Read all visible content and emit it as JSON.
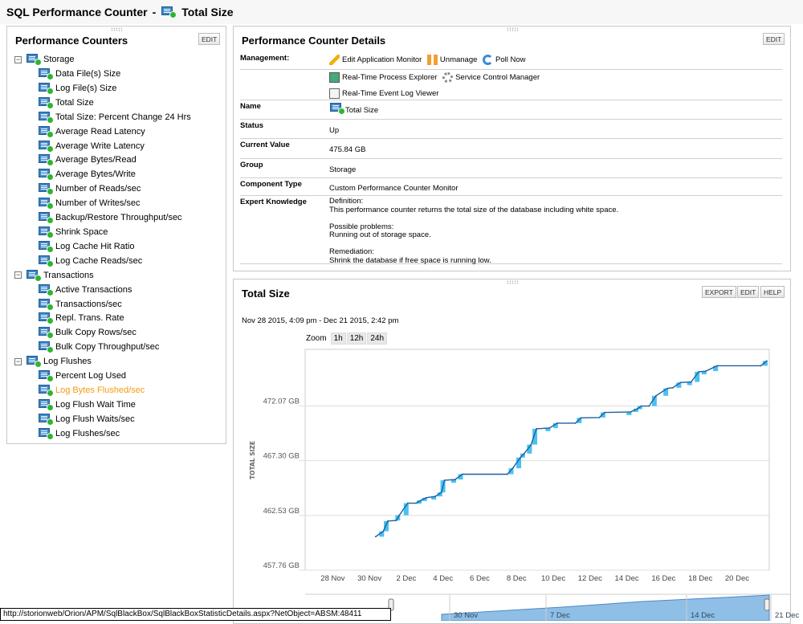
{
  "header": {
    "title": "SQL Performance Counter",
    "separator": "-",
    "counter": "Total Size"
  },
  "tree": {
    "title": "Performance Counters",
    "edit": "EDIT",
    "groups": [
      {
        "label": "Storage",
        "items": [
          "Data File(s) Size",
          "Log File(s) Size",
          "Total Size",
          "Total Size: Percent Change 24 Hrs",
          "Average Read Latency",
          "Average Write Latency",
          "Average Bytes/Read",
          "Average Bytes/Write",
          "Number of Reads/sec",
          "Number of Writes/sec",
          "Backup/Restore Throughput/sec",
          "Shrink Space",
          "Log Cache Hit Ratio",
          "Log Cache Reads/sec"
        ]
      },
      {
        "label": "Transactions",
        "items": [
          "Active Transactions",
          "Transactions/sec",
          "Repl. Trans. Rate",
          "Bulk Copy Rows/sec",
          "Bulk Copy Throughput/sec"
        ]
      },
      {
        "label": "Log Flushes",
        "items": [
          "Percent Log Used",
          "Log Bytes Flushed/sec",
          "Log Flush Wait Time",
          "Log Flush Waits/sec",
          "Log Flushes/sec"
        ]
      }
    ],
    "highlighted": "Log Bytes Flushed/sec",
    "highlight_color": "#f39c12"
  },
  "details": {
    "title": "Performance Counter Details",
    "edit": "EDIT",
    "management_label": "Management:",
    "management": {
      "edit_app": "Edit Application Monitor",
      "unmanage": "Unmanage",
      "poll": "Poll Now",
      "process_explorer": "Real-Time Process Explorer",
      "scm": "Service Control Manager",
      "event_log": "Real-Time Event Log Viewer"
    },
    "rows": [
      {
        "label": "Name",
        "value": "Total Size"
      },
      {
        "label": "Status",
        "value": "Up"
      },
      {
        "label": "Current Value",
        "value": "475.84 GB"
      },
      {
        "label": "Group",
        "value": "Storage"
      },
      {
        "label": "Component Type",
        "value": "Custom Performance Counter Monitor"
      }
    ],
    "expert": {
      "label": "Expert Knowledge",
      "def_h": "Definition:",
      "def": "This performance counter returns the total size of the database including white space.",
      "prob_h": "Possible problems:",
      "prob": "Running out of storage space.",
      "rem_h": "Remediation:",
      "rem": "Shrink the database if free space is running low."
    }
  },
  "chart_panel": {
    "title": "Total Size",
    "export": "EXPORT",
    "edit": "EDIT",
    "help": "HELP",
    "range": "Nov 28 2015, 4:09 pm - Dec 21 2015, 2:42 pm",
    "zoom_label": "Zoom",
    "zoom_options": [
      "1h",
      "12h",
      "24h"
    ]
  },
  "chart_data": {
    "type": "line",
    "title": "",
    "ylabel": "TOTAL SIZE",
    "xlabel": "",
    "ylim": [
      457.76,
      477.0
    ],
    "xlim": [
      "2015-11-26T12:00",
      "2015-12-21T18:00"
    ],
    "grid": true,
    "line_color": "#1f5f9e",
    "range_color": "#29b6f0",
    "yticks": [
      457.76,
      462.53,
      467.3,
      472.07
    ],
    "ytick_labels": [
      "457.76 GB",
      "462.53 GB",
      "467.30 GB",
      "472.07 GB"
    ],
    "xticks": [
      "2015-11-28",
      "2015-11-30",
      "2015-12-02",
      "2015-12-04",
      "2015-12-06",
      "2015-12-08",
      "2015-12-10",
      "2015-12-12",
      "2015-12-14",
      "2015-12-16",
      "2015-12-18",
      "2015-12-20"
    ],
    "xtick_labels": [
      "28 Nov",
      "30 Nov",
      "2 Dec",
      "4 Dec",
      "6 Dec",
      "8 Dec",
      "10 Dec",
      "12 Dec",
      "14 Dec",
      "16 Dec",
      "18 Dec",
      "20 Dec"
    ],
    "x": [
      "2015-11-30T08:00",
      "2015-11-30T18:00",
      "2015-12-01T00:00",
      "2015-12-01T11:00",
      "2015-12-01T15:00",
      "2015-12-02T02:00",
      "2015-12-02T13:00",
      "2015-12-02T19:00",
      "2015-12-03T02:00",
      "2015-12-03T14:00",
      "2015-12-03T22:00",
      "2015-12-04T02:00",
      "2015-12-04T16:00",
      "2015-12-05T01:00",
      "2015-12-07T12:00",
      "2015-12-07T19:00",
      "2015-12-08T05:00",
      "2015-12-08T10:00",
      "2015-12-08T19:00",
      "2015-12-09T02:00",
      "2015-12-09T19:00",
      "2015-12-10T05:00",
      "2015-12-11T05:00",
      "2015-12-11T12:00",
      "2015-12-12T12:00",
      "2015-12-12T19:00",
      "2015-12-14T05:00",
      "2015-12-14T14:00",
      "2015-12-14T19:00",
      "2015-12-15T05:00",
      "2015-12-15T14:00",
      "2015-12-16T05:00",
      "2015-12-16T12:00",
      "2015-12-16T22:00",
      "2015-12-17T12:00",
      "2015-12-17T22:00",
      "2015-12-18T07:00",
      "2015-12-18T22:00",
      "2015-12-21T07:00",
      "2015-12-21T14:42"
    ],
    "values": [
      460.68,
      461.15,
      462.04,
      462.09,
      462.55,
      463.6,
      463.6,
      463.84,
      464.07,
      464.19,
      464.54,
      465.59,
      465.66,
      466.12,
      466.12,
      466.64,
      467.57,
      467.92,
      468.7,
      470.08,
      470.15,
      470.57,
      470.57,
      471.03,
      471.06,
      471.5,
      471.55,
      471.83,
      472.06,
      472.06,
      472.95,
      473.6,
      473.65,
      474.11,
      474.16,
      475.05,
      475.1,
      475.57,
      475.57,
      475.99
    ],
    "navigator_labels": [
      "30 Nov",
      "7 Dec",
      "14 Dec",
      "21 Dec"
    ]
  },
  "statusbar": {
    "url": "http://storionweb/Orion/APM/SqlBlackBox/SqlBlackBoxStatisticDetails.aspx?NetObject=ABSM:48411"
  }
}
